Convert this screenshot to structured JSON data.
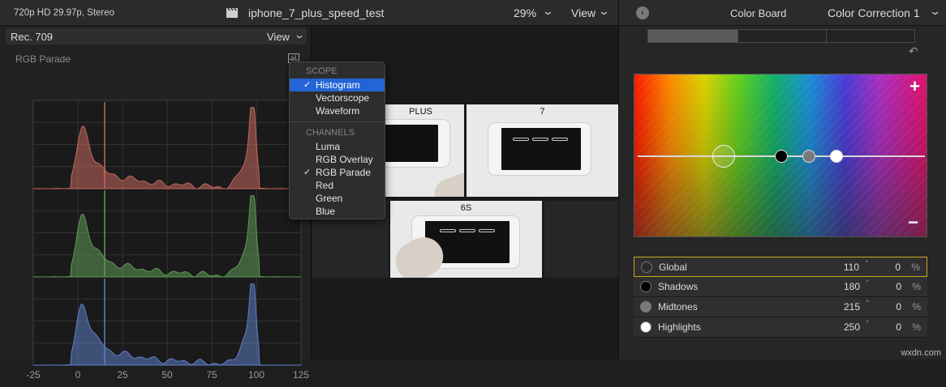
{
  "topbar": {
    "format": "720p HD 29.97p, Stereo",
    "project_title": "iphone_7_plus_speed_test",
    "zoom": "29%",
    "view_label": "View"
  },
  "scopes": {
    "color_space": "Rec. 709",
    "view_label": "View",
    "scope_name": "RGB Parade",
    "x_ticks": [
      "-25",
      "0",
      "25",
      "50",
      "75",
      "100",
      "125"
    ],
    "channel_colors": {
      "red": "#c4685f",
      "green": "#5e9a56",
      "blue": "#5f7ec4"
    }
  },
  "scope_menu": {
    "scope_header": "SCOPE",
    "scope_items": [
      {
        "label": "Histogram",
        "checked": true,
        "highlighted": true
      },
      {
        "label": "Vectorscope",
        "checked": false
      },
      {
        "label": "Waveform",
        "checked": false
      }
    ],
    "channels_header": "CHANNELS",
    "channel_items": [
      {
        "label": "Luma",
        "checked": false
      },
      {
        "label": "RGB Overlay",
        "checked": false
      },
      {
        "label": "RGB Parade",
        "checked": true
      },
      {
        "label": "Red",
        "checked": false
      },
      {
        "label": "Green",
        "checked": false
      },
      {
        "label": "Blue",
        "checked": false
      }
    ],
    "check_glyph": "✓"
  },
  "viewer": {
    "labels": {
      "tile1": "PLUS",
      "tile2": "7",
      "tile3": "6S"
    }
  },
  "color_board": {
    "panel_title": "Color Board",
    "correction_name": "Color Correction 1",
    "plus_glyph": "+",
    "minus_glyph": "−",
    "rows": [
      {
        "name": "Global",
        "value1": "110",
        "value2": "0",
        "unit": "%",
        "active": true,
        "dot_color": "#2b2b2b"
      },
      {
        "name": "Shadows",
        "value1": "180",
        "value2": "0",
        "unit": "%",
        "active": false,
        "dot_color": "#000000"
      },
      {
        "name": "Midtones",
        "value1": "215",
        "value2": "0",
        "unit": "%",
        "active": false,
        "dot_color": "#7a7a7a"
      },
      {
        "name": "Highlights",
        "value1": "250",
        "value2": "0",
        "unit": "%",
        "active": false,
        "dot_color": "#ffffff"
      }
    ],
    "degree_glyph": "°"
  },
  "watermark": "wxdn.com"
}
